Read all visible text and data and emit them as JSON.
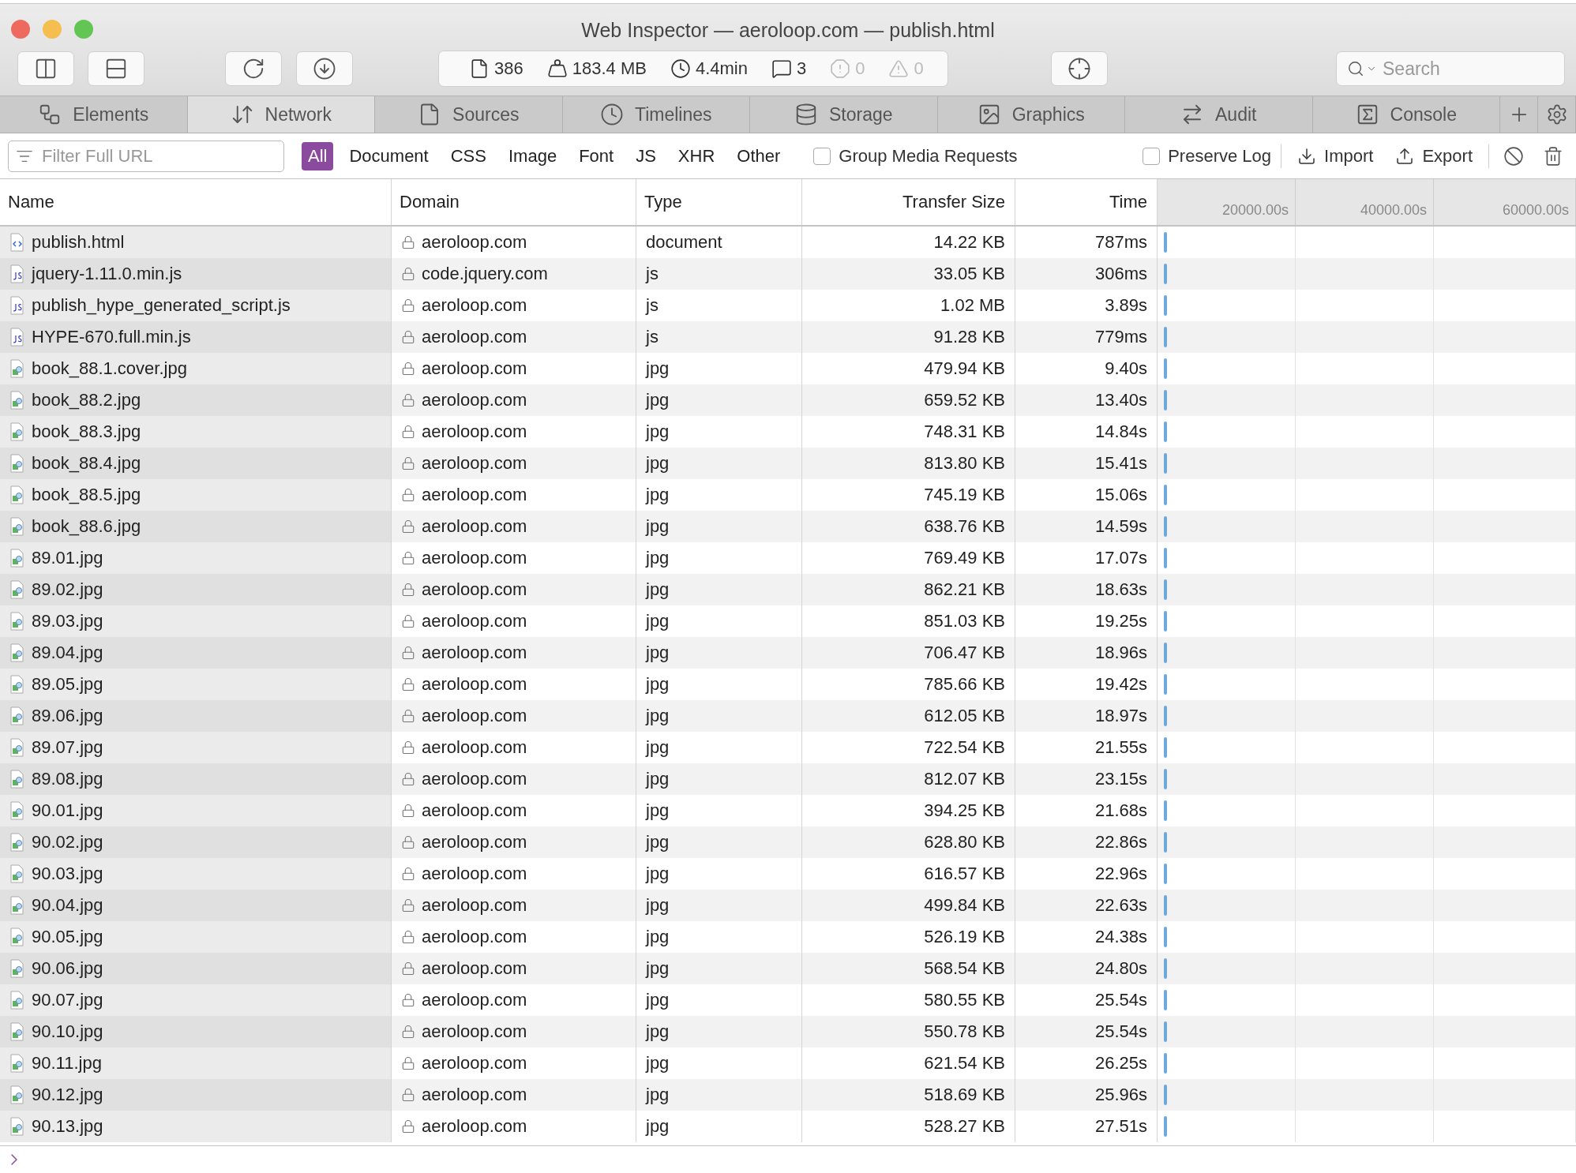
{
  "window": {
    "title": "Web Inspector — aeroloop.com — publish.html"
  },
  "stats": [
    {
      "value": "386",
      "dimmed": false
    },
    {
      "value": "183.4 MB",
      "dimmed": false
    },
    {
      "value": "4.4min",
      "dimmed": false
    },
    {
      "value": "3",
      "dimmed": false
    },
    {
      "value": "0",
      "dimmed": true
    },
    {
      "value": "0",
      "dimmed": true
    }
  ],
  "search": {
    "placeholder": "Search"
  },
  "tabs": [
    {
      "label": "Elements",
      "selected": false
    },
    {
      "label": "Network",
      "selected": true
    },
    {
      "label": "Sources",
      "selected": false
    },
    {
      "label": "Timelines",
      "selected": false
    },
    {
      "label": "Storage",
      "selected": false
    },
    {
      "label": "Graphics",
      "selected": false
    },
    {
      "label": "Audit",
      "selected": false
    },
    {
      "label": "Console",
      "selected": false
    }
  ],
  "filter": {
    "placeholder": "Filter Full URL"
  },
  "types": [
    {
      "label": "All",
      "selected": true
    },
    {
      "label": "Document",
      "selected": false
    },
    {
      "label": "CSS",
      "selected": false
    },
    {
      "label": "Image",
      "selected": false
    },
    {
      "label": "Font",
      "selected": false
    },
    {
      "label": "JS",
      "selected": false
    },
    {
      "label": "XHR",
      "selected": false
    },
    {
      "label": "Other",
      "selected": false
    }
  ],
  "group_media": {
    "label": "Group Media Requests",
    "checked": false
  },
  "preserve_log": {
    "label": "Preserve Log",
    "checked": false
  },
  "actions": [
    "Import",
    "Export"
  ],
  "table": {
    "columns": [
      "Name",
      "Domain",
      "Type",
      "Transfer Size",
      "Time"
    ],
    "timeline_ticks": [
      "20000.00s",
      "40000.00s",
      "60000.00s"
    ],
    "rows": [
      {
        "kind": "document",
        "name": "publish.html",
        "domain": "aeroloop.com",
        "type": "document",
        "size": "14.22 KB",
        "time": "787ms"
      },
      {
        "kind": "script",
        "name": "jquery-1.11.0.min.js",
        "domain": "code.jquery.com",
        "type": "js",
        "size": "33.05 KB",
        "time": "306ms"
      },
      {
        "kind": "script",
        "name": "publish_hype_generated_script.js",
        "domain": "aeroloop.com",
        "type": "js",
        "size": "1.02 MB",
        "time": "3.89s"
      },
      {
        "kind": "script",
        "name": "HYPE-670.full.min.js",
        "domain": "aeroloop.com",
        "type": "js",
        "size": "91.28 KB",
        "time": "779ms"
      },
      {
        "kind": "image",
        "name": "book_88.1.cover.jpg",
        "domain": "aeroloop.com",
        "type": "jpg",
        "size": "479.94 KB",
        "time": "9.40s"
      },
      {
        "kind": "image",
        "name": "book_88.2.jpg",
        "domain": "aeroloop.com",
        "type": "jpg",
        "size": "659.52 KB",
        "time": "13.40s"
      },
      {
        "kind": "image",
        "name": "book_88.3.jpg",
        "domain": "aeroloop.com",
        "type": "jpg",
        "size": "748.31 KB",
        "time": "14.84s"
      },
      {
        "kind": "image",
        "name": "book_88.4.jpg",
        "domain": "aeroloop.com",
        "type": "jpg",
        "size": "813.80 KB",
        "time": "15.41s"
      },
      {
        "kind": "image",
        "name": "book_88.5.jpg",
        "domain": "aeroloop.com",
        "type": "jpg",
        "size": "745.19 KB",
        "time": "15.06s"
      },
      {
        "kind": "image",
        "name": "book_88.6.jpg",
        "domain": "aeroloop.com",
        "type": "jpg",
        "size": "638.76 KB",
        "time": "14.59s"
      },
      {
        "kind": "image",
        "name": "89.01.jpg",
        "domain": "aeroloop.com",
        "type": "jpg",
        "size": "769.49 KB",
        "time": "17.07s"
      },
      {
        "kind": "image",
        "name": "89.02.jpg",
        "domain": "aeroloop.com",
        "type": "jpg",
        "size": "862.21 KB",
        "time": "18.63s"
      },
      {
        "kind": "image",
        "name": "89.03.jpg",
        "domain": "aeroloop.com",
        "type": "jpg",
        "size": "851.03 KB",
        "time": "19.25s"
      },
      {
        "kind": "image",
        "name": "89.04.jpg",
        "domain": "aeroloop.com",
        "type": "jpg",
        "size": "706.47 KB",
        "time": "18.96s"
      },
      {
        "kind": "image",
        "name": "89.05.jpg",
        "domain": "aeroloop.com",
        "type": "jpg",
        "size": "785.66 KB",
        "time": "19.42s"
      },
      {
        "kind": "image",
        "name": "89.06.jpg",
        "domain": "aeroloop.com",
        "type": "jpg",
        "size": "612.05 KB",
        "time": "18.97s"
      },
      {
        "kind": "image",
        "name": "89.07.jpg",
        "domain": "aeroloop.com",
        "type": "jpg",
        "size": "722.54 KB",
        "time": "21.55s"
      },
      {
        "kind": "image",
        "name": "89.08.jpg",
        "domain": "aeroloop.com",
        "type": "jpg",
        "size": "812.07 KB",
        "time": "23.15s"
      },
      {
        "kind": "image",
        "name": "90.01.jpg",
        "domain": "aeroloop.com",
        "type": "jpg",
        "size": "394.25 KB",
        "time": "21.68s"
      },
      {
        "kind": "image",
        "name": "90.02.jpg",
        "domain": "aeroloop.com",
        "type": "jpg",
        "size": "628.80 KB",
        "time": "22.86s"
      },
      {
        "kind": "image",
        "name": "90.03.jpg",
        "domain": "aeroloop.com",
        "type": "jpg",
        "size": "616.57 KB",
        "time": "22.96s"
      },
      {
        "kind": "image",
        "name": "90.04.jpg",
        "domain": "aeroloop.com",
        "type": "jpg",
        "size": "499.84 KB",
        "time": "22.63s"
      },
      {
        "kind": "image",
        "name": "90.05.jpg",
        "domain": "aeroloop.com",
        "type": "jpg",
        "size": "526.19 KB",
        "time": "24.38s"
      },
      {
        "kind": "image",
        "name": "90.06.jpg",
        "domain": "aeroloop.com",
        "type": "jpg",
        "size": "568.54 KB",
        "time": "24.80s"
      },
      {
        "kind": "image",
        "name": "90.07.jpg",
        "domain": "aeroloop.com",
        "type": "jpg",
        "size": "580.55 KB",
        "time": "25.54s"
      },
      {
        "kind": "image",
        "name": "90.10.jpg",
        "domain": "aeroloop.com",
        "type": "jpg",
        "size": "550.78 KB",
        "time": "25.54s"
      },
      {
        "kind": "image",
        "name": "90.11.jpg",
        "domain": "aeroloop.com",
        "type": "jpg",
        "size": "621.54 KB",
        "time": "26.25s"
      },
      {
        "kind": "image",
        "name": "90.12.jpg",
        "domain": "aeroloop.com",
        "type": "jpg",
        "size": "518.69 KB",
        "time": "25.96s"
      },
      {
        "kind": "image",
        "name": "90.13.jpg",
        "domain": "aeroloop.com",
        "type": "jpg",
        "size": "528.27 KB",
        "time": "27.51s"
      }
    ]
  }
}
